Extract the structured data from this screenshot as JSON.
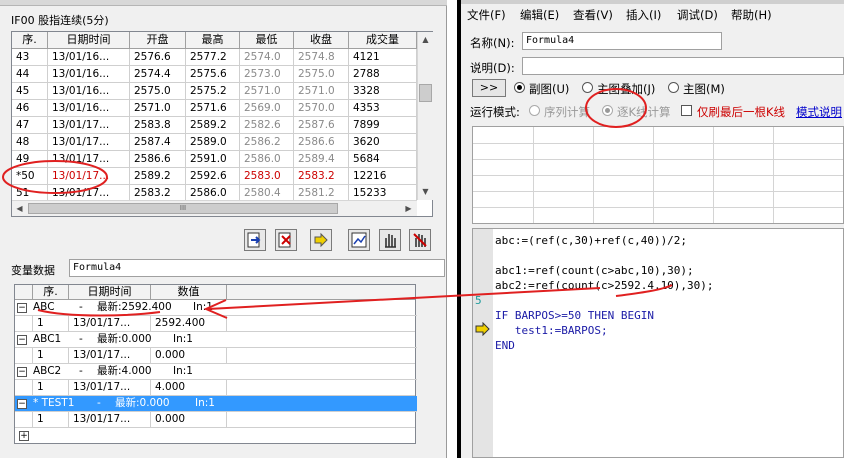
{
  "left": {
    "title": "IF00 股指连续(5分)",
    "quote_headers": [
      "序.",
      "日期时间",
      "开盘",
      "最高",
      "最低",
      "收盘",
      "成交量"
    ],
    "quote_rows": [
      [
        "43",
        "13/01/16...",
        "2576.6",
        "2577.2",
        "2574.0",
        "2574.8",
        "4121"
      ],
      [
        "44",
        "13/01/16...",
        "2574.4",
        "2575.6",
        "2573.0",
        "2575.0",
        "2788"
      ],
      [
        "45",
        "13/01/16...",
        "2575.0",
        "2575.2",
        "2571.0",
        "2571.0",
        "3328"
      ],
      [
        "46",
        "13/01/16...",
        "2571.0",
        "2571.6",
        "2569.0",
        "2570.0",
        "4353"
      ],
      [
        "47",
        "13/01/17...",
        "2583.8",
        "2589.2",
        "2582.6",
        "2587.6",
        "7899"
      ],
      [
        "48",
        "13/01/17...",
        "2587.4",
        "2589.0",
        "2586.2",
        "2586.6",
        "3620"
      ],
      [
        "49",
        "13/01/17...",
        "2586.6",
        "2591.0",
        "2586.0",
        "2589.4",
        "5684"
      ],
      [
        "*50",
        "13/01/17...",
        "2589.2",
        "2592.6",
        "2583.0",
        "2583.2",
        "12216"
      ],
      [
        "51",
        "13/01/17...",
        "2583.2",
        "2586.0",
        "2580.4",
        "2581.2",
        "15233"
      ]
    ],
    "hscroll_label": "III",
    "var_label": "变量数据",
    "var_formula": "Formula4",
    "var_headers": [
      "序.",
      "日期时间",
      "数值"
    ],
    "var_groups": [
      {
        "name": "ABC",
        "latest": "最新:2592.400",
        "ln": "In:1",
        "row": [
          "1",
          "13/01/17...",
          "2592.400"
        ]
      },
      {
        "name": "ABC1",
        "latest": "最新:0.000",
        "ln": "In:1",
        "row": [
          "1",
          "13/01/17...",
          "0.000"
        ]
      },
      {
        "name": "ABC2",
        "latest": "最新:4.000",
        "ln": "In:1",
        "row": [
          "1",
          "13/01/17...",
          "4.000"
        ]
      },
      {
        "name": "* TEST1",
        "latest": "最新:0.000",
        "ln": "In:1",
        "row": [
          "1",
          "13/01/17...",
          "0.000"
        ]
      }
    ],
    "expand_symbol": "+"
  },
  "right": {
    "menu": [
      "文件(F)",
      "编辑(E)",
      "查看(V)",
      "插入(I)",
      "调试(D)",
      "帮助(H)"
    ],
    "name_label": "名称(N):",
    "name_value": "Formula4",
    "desc_label": "说明(D):",
    "expand_btn": ">>",
    "radio_sub": "副图(U)",
    "radio_overlay": "主图叠加(J)",
    "radio_main": "主图(M)",
    "run_mode_label": "运行模式:",
    "run_seq": "序列计算",
    "run_step": "逐K线计算",
    "refresh_last": "仅刷最后一根K线",
    "mode_help": "模式说明",
    "code_lines": [
      "abc:=(ref(c,30)+ref(c,40))/2;",
      "",
      "abc1:=ref(count(c>abc,10),30);",
      "abc2:=ref(count(c>2592.4,10),30);",
      "",
      "IF BARPOS>=50 THEN BEGIN",
      "   test1:=BARPOS;",
      "END"
    ],
    "line_number": "5"
  }
}
